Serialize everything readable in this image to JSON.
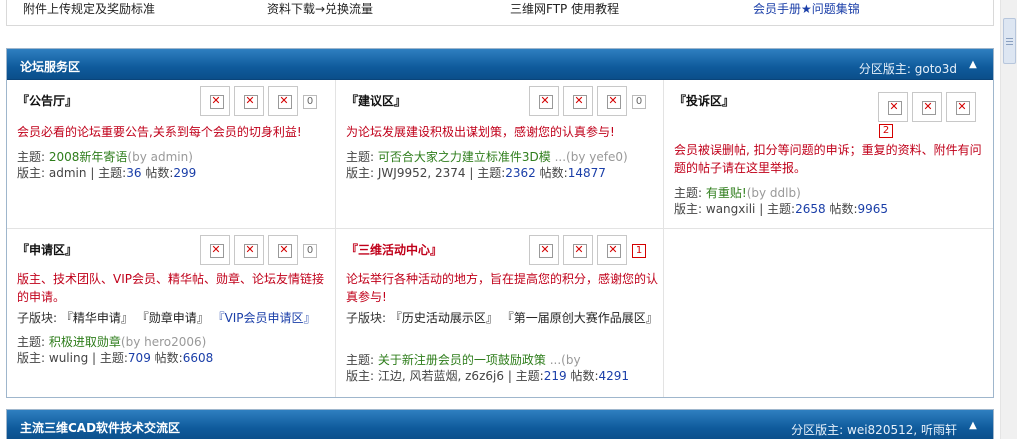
{
  "top_links": [
    "附件上传规定及奖励标准",
    "资料下载→兑换流量",
    "三维网FTP 使用教程",
    "会员手册★问题集锦"
  ],
  "section1": {
    "title": "论坛服务区",
    "moderator_label": "分区版主:",
    "moderator": "goto3d",
    "forums": [
      {
        "name": "『公告厅』",
        "count": "0",
        "desc": "会员必看的论坛重要公告,关系到每个会员的切身利益!",
        "topic_label": "主题:",
        "topic": "2008新年寄语",
        "by": "(by admin)",
        "mod_label": "版主:",
        "mods": "admin",
        "stats_topics_label": "| 主题:",
        "stats_topics": "36",
        "stats_posts_label": "帖数:",
        "stats_posts": "299"
      },
      {
        "name": "『建议区』",
        "count": "0",
        "desc": "为论坛发展建设积极出谋划策，感谢您的认真参与!",
        "topic_label": "主题:",
        "topic": "可否合大家之力建立标准件3D模",
        "by": "...(by yefe0)",
        "mod_label": "版主:",
        "mods": "JWJ9952, 2374",
        "stats_topics_label": "| 主题:",
        "stats_topics": "2362",
        "stats_posts_label": "帖数:",
        "stats_posts": "14877"
      },
      {
        "name": "『投诉区』",
        "count": "2",
        "desc": "会员被误删帖, 扣分等问题的申诉；重复的资料、附件有问题的帖子请在这里举报。",
        "topic_label": "主题:",
        "topic": "有重贴!",
        "by": "(by ddlb)",
        "mod_label": "版主:",
        "mods": "wangxili",
        "stats_topics_label": "| 主题:",
        "stats_topics": "2658",
        "stats_posts_label": "帖数:",
        "stats_posts": "9965"
      },
      {
        "name": "『申请区』",
        "count": "0",
        "desc": "版主、技术团队、VIP会员、精华帖、勋章、论坛友情链接的申请。",
        "sub_label": "子版块:",
        "subs": [
          "『精华申请』",
          "『勋章申请』",
          "『VIP会员申请区』"
        ],
        "topic_label": "主题:",
        "topic": "积极进取勋章",
        "by": "(by hero2006)",
        "mod_label": "版主:",
        "mods": "wuling",
        "stats_topics_label": "| 主题:",
        "stats_topics": "709",
        "stats_posts_label": "帖数:",
        "stats_posts": "6608"
      },
      {
        "name": "『三维活动中心』",
        "count": "1",
        "desc": "论坛举行各种活动的地方，旨在提高您的积分，感谢您的认真参与!",
        "sub_label": "子版块:",
        "subs": [
          "『历史活动展示区』",
          "『第一届原创大赛作品展区』"
        ],
        "topic_label": "主题:",
        "topic": "关于新注册会员的一项鼓励政策",
        "by": "...(by",
        "mod_label": "版主:",
        "mods": "江边, 风若蓝烟, z6z6j6",
        "stats_topics_label": "| 主题:",
        "stats_topics": "219",
        "stats_posts_label": "帖数:",
        "stats_posts": "4291"
      }
    ]
  },
  "section2": {
    "title": "主流三维CAD软件技术交流区",
    "moderator_label": "分区版主:",
    "moderator": "wei820512, 听雨轩"
  },
  "icons": {
    "broken_image": "✕",
    "collapse": "▲"
  }
}
